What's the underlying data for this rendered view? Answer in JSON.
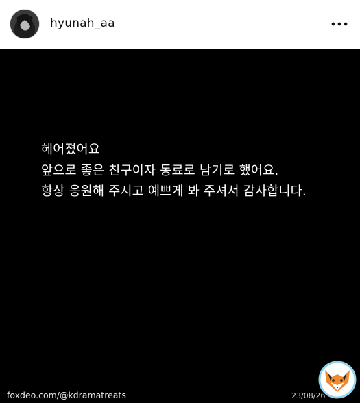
{
  "header": {
    "username": "hyunah_aa",
    "more_icon": "more-horizontal-icon"
  },
  "post": {
    "lines": [
      "헤어졌어요",
      "앞으로 좋은 친구이자 동료로 남기로 했어요.",
      "항상 응원해 주시고 예쁘게 봐 주셔서 감사합니다."
    ]
  },
  "watermark": {
    "site": "foxdeo.com/@kdramatreats",
    "date": "23/08/26",
    "logo_icon": "fox-logo-icon"
  },
  "colors": {
    "header_bg": "#ffffff",
    "post_bg": "#000000",
    "text": "#ffffff",
    "fox_orange": "#f08a2c",
    "fox_ring": "#8fd3e8"
  }
}
